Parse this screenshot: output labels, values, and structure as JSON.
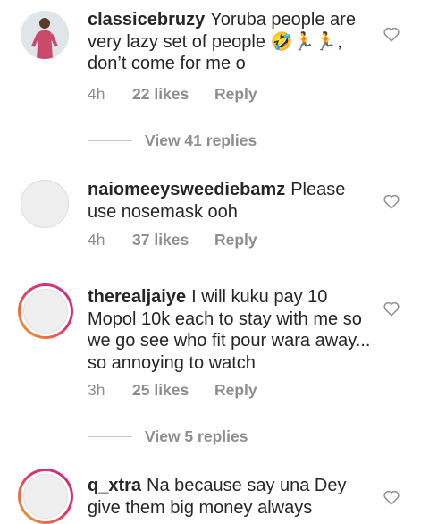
{
  "comments": [
    {
      "username": "classicebruzy",
      "text": "Yoruba people are very lazy set of people 🤣🏃🏃, don’t come for me o",
      "time": "4h",
      "likes": "22 likes",
      "reply": "Reply",
      "view_replies": "View 41 replies",
      "avatar": "photo"
    },
    {
      "username": "naiomeeysweediebamz",
      "text": "Please use nosemask ooh",
      "time": "4h",
      "likes": "37 likes",
      "reply": "Reply",
      "avatar": "plain"
    },
    {
      "username": "therealjaiye",
      "text": "I will kuku pay 10 Mopol 10k each to stay with me so we go see who fit pour wara away... so annoying to watch",
      "time": "3h",
      "likes": "25 likes",
      "reply": "Reply",
      "view_replies": "View 5 replies",
      "avatar": "story"
    },
    {
      "username": "q_xtra",
      "text": "Na because say una Dey give them big money always",
      "avatar": "story"
    }
  ],
  "icons": {
    "like": "heart-outline-icon"
  },
  "colors": {
    "text": "#262626",
    "secondary": "#8e8e8e",
    "story_ring_start": "#f5a623",
    "story_ring_end": "#c13584"
  }
}
